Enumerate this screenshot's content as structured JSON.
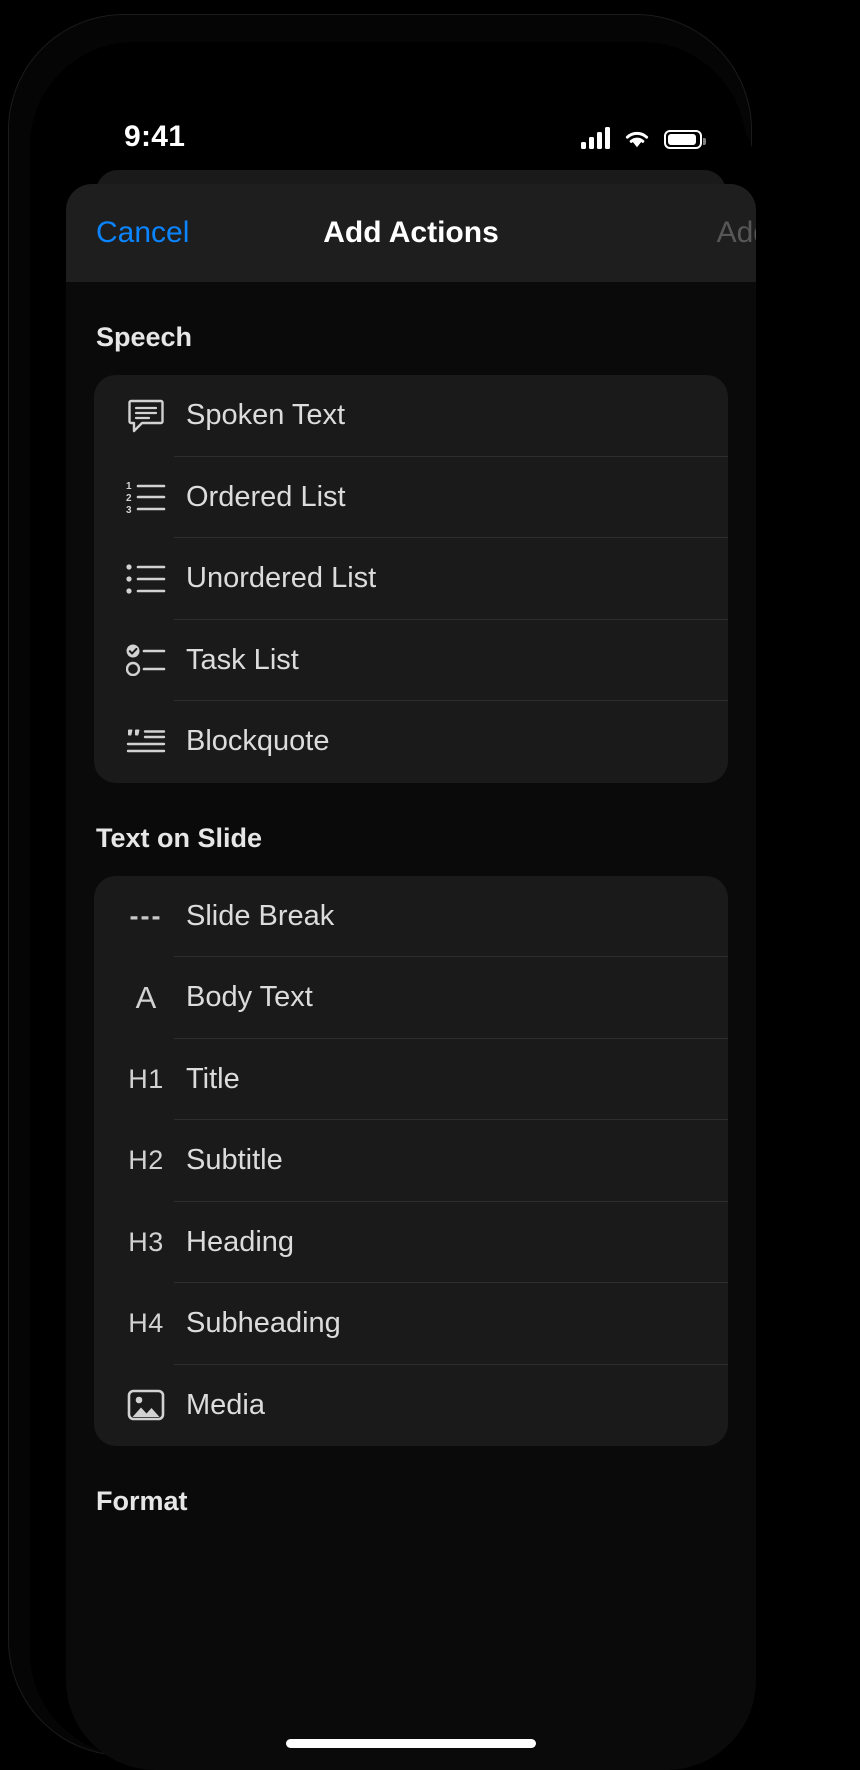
{
  "status_bar": {
    "time": "9:41",
    "cellular_icon": "cellular-signal-icon",
    "wifi_icon": "wifi-icon",
    "battery_icon": "battery-icon"
  },
  "nav": {
    "cancel_label": "Cancel",
    "title": "Add Actions",
    "add_label": "Add",
    "accent_color": "#0a84ff",
    "disabled_color": "#575757"
  },
  "sections": [
    {
      "header": "Speech",
      "items": [
        {
          "label": "Spoken Text",
          "icon": "speech-bubble-icon"
        },
        {
          "label": "Ordered List",
          "icon": "ordered-list-icon"
        },
        {
          "label": "Unordered List",
          "icon": "unordered-list-icon"
        },
        {
          "label": "Task List",
          "icon": "task-list-icon"
        },
        {
          "label": "Blockquote",
          "icon": "blockquote-icon"
        }
      ]
    },
    {
      "header": "Text on Slide",
      "items": [
        {
          "label": "Slide Break",
          "icon": "dashes-icon",
          "glyph": "---"
        },
        {
          "label": "Body Text",
          "icon": "letter-a-icon",
          "glyph": "A"
        },
        {
          "label": "Title",
          "icon": "heading-1-icon",
          "glyph": "H1"
        },
        {
          "label": "Subtitle",
          "icon": "heading-2-icon",
          "glyph": "H2"
        },
        {
          "label": "Heading",
          "icon": "heading-3-icon",
          "glyph": "H3"
        },
        {
          "label": "Subheading",
          "icon": "heading-4-icon",
          "glyph": "H4"
        },
        {
          "label": "Media",
          "icon": "photo-icon"
        }
      ]
    },
    {
      "header": "Format",
      "items": []
    }
  ]
}
